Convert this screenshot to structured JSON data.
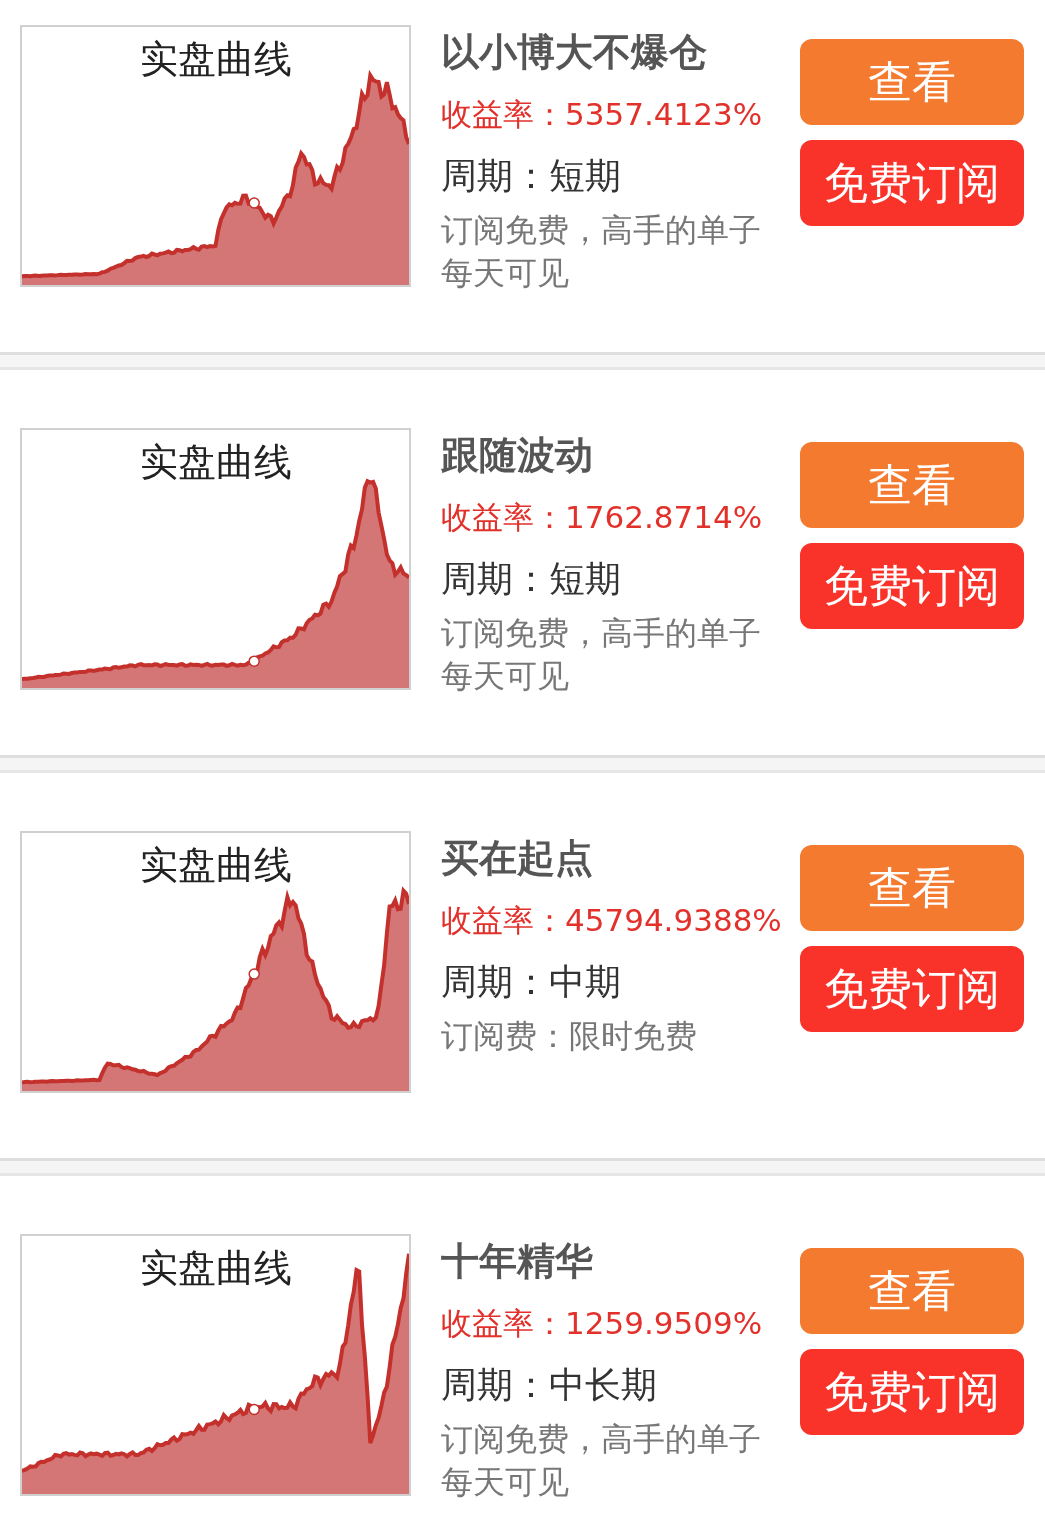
{
  "cards": [
    {
      "chart_title": "实盘曲线",
      "name": "以小博大不爆仓",
      "yield": "收益率：5357.4123%",
      "period": "周期：短期",
      "description": "订阅免费，高手的单子每天可见",
      "buttons": [
        {
          "kind": "view",
          "label": "查看"
        },
        {
          "kind": "subscribe",
          "label": "免费订阅"
        }
      ]
    },
    {
      "chart_title": "实盘曲线",
      "name": "跟随波动",
      "yield": "收益率：1762.8714%",
      "period": "周期：短期",
      "description": "订阅免费，高手的单子每天可见",
      "buttons": [
        {
          "kind": "view",
          "label": "查看"
        },
        {
          "kind": "subscribe",
          "label": "免费订阅"
        }
      ]
    },
    {
      "chart_title": "实盘曲线",
      "name": "买在起点",
      "yield": "收益率：45794.9388%",
      "period": "周期：中期",
      "description": "订阅费：限时免费",
      "buttons": [
        {
          "kind": "view",
          "label": "查看"
        },
        {
          "kind": "subscribe",
          "label": "免费订阅"
        }
      ]
    },
    {
      "chart_title": "实盘曲线",
      "name": "十年精华",
      "yield": "收益率：1259.9509%",
      "period": "周期：中长期",
      "description": "订阅免费，高手的单子每天可见",
      "buttons": [
        {
          "kind": "view",
          "label": "查看"
        },
        {
          "kind": "subscribe",
          "label": "免费订阅"
        }
      ]
    }
  ]
}
